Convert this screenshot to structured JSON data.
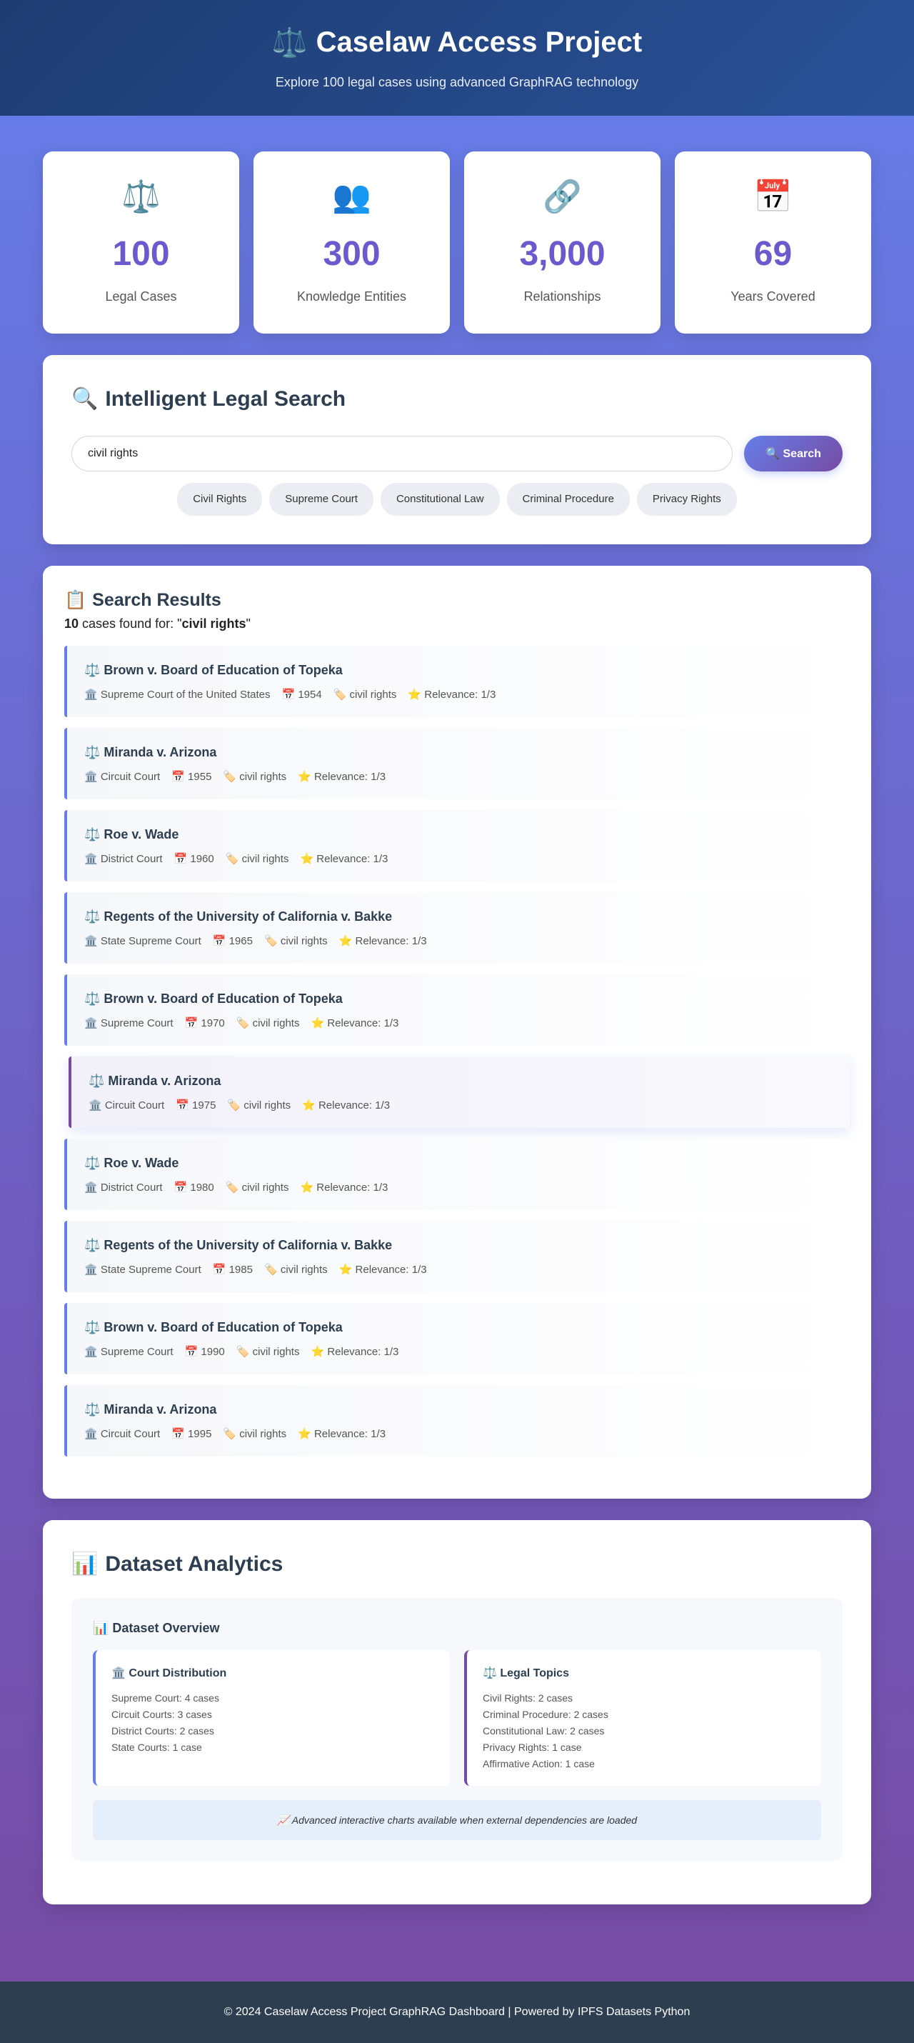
{
  "header": {
    "icon": "⚖️",
    "title": "Caselaw Access Project",
    "subtitle": "Explore 100 legal cases using advanced GraphRAG technology"
  },
  "stats": [
    {
      "icon": "⚖️",
      "value": "100",
      "label": "Legal Cases"
    },
    {
      "icon": "👥",
      "value": "300",
      "label": "Knowledge Entities"
    },
    {
      "icon": "🔗",
      "value": "3,000",
      "label": "Relationships"
    },
    {
      "icon": "📅",
      "value": "69",
      "label": "Years Covered"
    }
  ],
  "search": {
    "icon": "🔍",
    "title": "Intelligent Legal Search",
    "value": "civil rights",
    "button_label": "🔍 Search",
    "chips": [
      "Civil Rights",
      "Supreme Court",
      "Constitutional Law",
      "Criminal Procedure",
      "Privacy Rights"
    ]
  },
  "results": {
    "icon": "📋",
    "title": "Search Results",
    "count": "10",
    "count_text": " cases found for: \"",
    "query": "civil rights",
    "count_end": "\"",
    "items": [
      {
        "title": "⚖️ Brown v. Board of Education of Topeka",
        "court": "🏛️ Supreme Court of the United States",
        "year": "📅 1954",
        "tag": "🏷️ civil rights",
        "relevance": "⭐ Relevance: 1/3"
      },
      {
        "title": "⚖️ Miranda v. Arizona",
        "court": "🏛️ Circuit Court",
        "year": "📅 1955",
        "tag": "🏷️ civil rights",
        "relevance": "⭐ Relevance: 1/3"
      },
      {
        "title": "⚖️ Roe v. Wade",
        "court": "🏛️ District Court",
        "year": "📅 1960",
        "tag": "🏷️ civil rights",
        "relevance": "⭐ Relevance: 1/3"
      },
      {
        "title": "⚖️ Regents of the University of California v. Bakke",
        "court": "🏛️ State Supreme Court",
        "year": "📅 1965",
        "tag": "🏷️ civil rights",
        "relevance": "⭐ Relevance: 1/3"
      },
      {
        "title": "⚖️ Brown v. Board of Education of Topeka",
        "court": "🏛️ Supreme Court",
        "year": "📅 1970",
        "tag": "🏷️ civil rights",
        "relevance": "⭐ Relevance: 1/3"
      },
      {
        "title": "⚖️ Miranda v. Arizona",
        "court": "🏛️ Circuit Court",
        "year": "📅 1975",
        "tag": "🏷️ civil rights",
        "relevance": "⭐ Relevance: 1/3"
      },
      {
        "title": "⚖️ Roe v. Wade",
        "court": "🏛️ District Court",
        "year": "📅 1980",
        "tag": "🏷️ civil rights",
        "relevance": "⭐ Relevance: 1/3"
      },
      {
        "title": "⚖️ Regents of the University of California v. Bakke",
        "court": "🏛️ State Supreme Court",
        "year": "📅 1985",
        "tag": "🏷️ civil rights",
        "relevance": "⭐ Relevance: 1/3"
      },
      {
        "title": "⚖️ Brown v. Board of Education of Topeka",
        "court": "🏛️ Supreme Court",
        "year": "📅 1990",
        "tag": "🏷️ civil rights",
        "relevance": "⭐ Relevance: 1/3"
      },
      {
        "title": "⚖️ Miranda v. Arizona",
        "court": "🏛️ Circuit Court",
        "year": "📅 1995",
        "tag": "🏷️ civil rights",
        "relevance": "⭐ Relevance: 1/3"
      }
    ]
  },
  "analytics": {
    "icon": "📊",
    "title": "Dataset Analytics",
    "overview_title": "📊 Dataset Overview",
    "court_title": "🏛️ Court Distribution",
    "court_items": [
      "Supreme Court: 4 cases",
      "Circuit Courts: 3 cases",
      "District Courts: 2 cases",
      "State Courts: 1 case"
    ],
    "topics_title": "⚖️ Legal Topics",
    "topic_items": [
      "Civil Rights: 2 cases",
      "Criminal Procedure: 2 cases",
      "Constitutional Law: 2 cases",
      "Privacy Rights: 1 case",
      "Affirmative Action: 1 case"
    ],
    "notice": "📈 Advanced interactive charts available when external dependencies are loaded"
  },
  "footer": {
    "text": "© 2024 Caselaw Access Project GraphRAG Dashboard | Powered by IPFS Datasets Python"
  },
  "colors": {
    "accent": "#667eea",
    "accent_dark": "#764ba2",
    "header": "#1e3c72",
    "footer": "#2c3e50",
    "stat_value": "#6a5acd"
  }
}
